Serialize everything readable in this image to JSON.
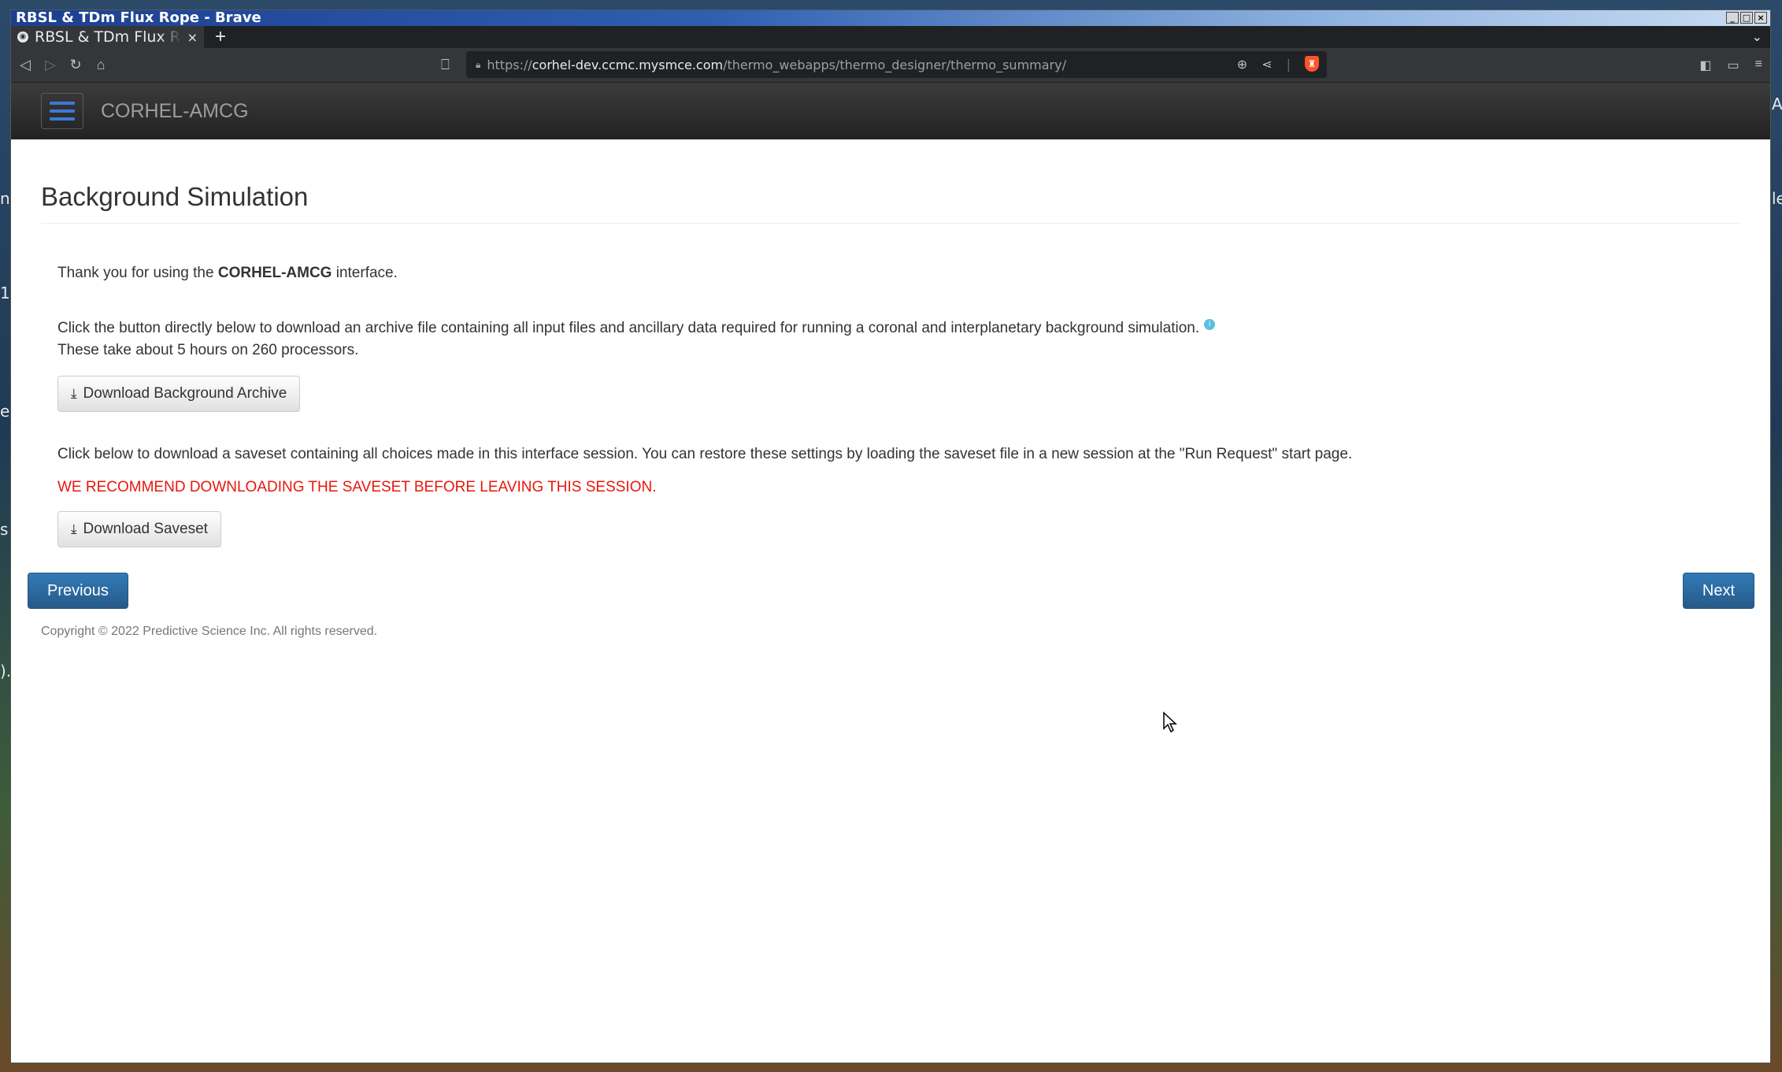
{
  "os": {
    "window_title": "RBSL & TDm Flux Rope - Brave",
    "controls": [
      "_",
      "□",
      "×"
    ]
  },
  "browser": {
    "tab": {
      "title": "RBSL & TDm Flux Rope",
      "close": "×"
    },
    "new_tab": "+",
    "tab_list": "⌄",
    "url": {
      "scheme": "https://",
      "host": "corhel-dev.ccmc.mysmce.com",
      "path": "/thermo_webapps/thermo_designer/thermo_summary/"
    },
    "icons": [
      "back-icon",
      "forward-icon",
      "reload-icon",
      "home-icon",
      "bookmark-icon",
      "lock-icon",
      "zoom-icon",
      "share-icon",
      "brave-shield-icon",
      "sidebar-icon",
      "wallet-icon",
      "menu-icon"
    ]
  },
  "app": {
    "brand": "CORHEL-AMCG"
  },
  "page": {
    "title": "Background Simulation",
    "intro_prefix": "Thank you for using the ",
    "intro_bold": "CORHEL-AMCG",
    "intro_suffix": " interface.",
    "archive_text_1": "Click the button directly below to download an archive file containing all input files and ancillary data required for running a coronal and interplanetary background simulation.",
    "archive_text_2": "These take about 5 hours on 260 processors.",
    "download_archive_label": "Download Background Archive",
    "saveset_text": "Click below to download a saveset containing all choices made in this interface session. You can restore these settings by loading the saveset file in a new session at the \"Run Request\" start page.",
    "warning": "WE RECOMMEND DOWNLOADING THE SAVESET BEFORE LEAVING THIS SESSION.",
    "download_saveset_label": "Download Saveset",
    "previous_label": "Previous",
    "next_label": "Next",
    "copyright": "Copyright © 2022 Predictive Science Inc. All rights reserved."
  },
  "colors": {
    "primary": "#337ab7",
    "warning": "#e8170c",
    "navbar": "#222222"
  }
}
